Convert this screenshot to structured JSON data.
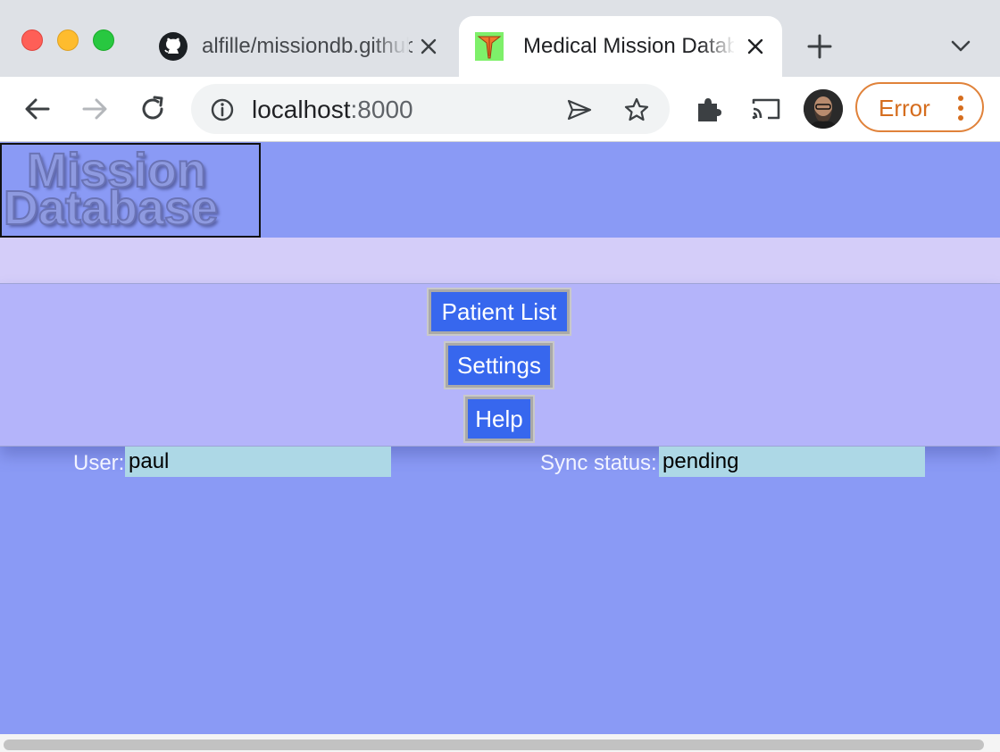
{
  "browser": {
    "tabs": [
      {
        "title": "alfille/missiondb.github",
        "icon": "github-icon"
      },
      {
        "title": "Medical Mission Database",
        "icon": "mission-favicon",
        "active": true
      }
    ],
    "address": {
      "host": "localhost",
      "port": ":8000"
    },
    "profile_button": "Error"
  },
  "app": {
    "logo_line1": "Mission",
    "logo_line2": "Database",
    "menu": [
      {
        "label": "Patient List"
      },
      {
        "label": "Settings"
      },
      {
        "label": "Help"
      }
    ],
    "status": {
      "user_label": "User:",
      "user_value": "paul",
      "sync_label": "Sync status:",
      "sync_value": "pending"
    }
  },
  "colors": {
    "page_background": "#8a9af5",
    "menu_panel": "#b4b4fa",
    "button": "#3767ee",
    "status_value_bg": "#add8e6",
    "error_accent": "#e0823a"
  }
}
